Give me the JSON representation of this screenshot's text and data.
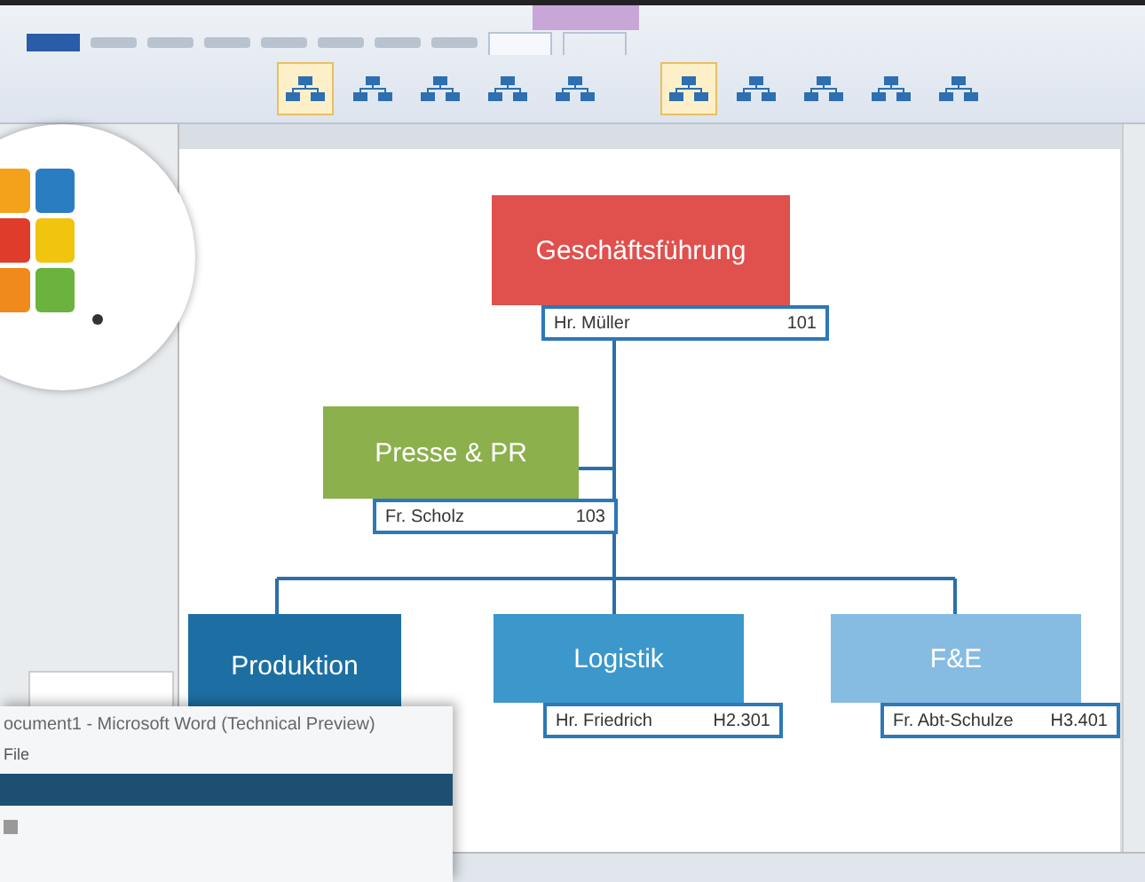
{
  "ribbon": {
    "contextual_tab_selected": true,
    "layout_gallery": [
      {
        "selected": true
      },
      {
        "selected": false
      },
      {
        "selected": false
      },
      {
        "selected": false
      },
      {
        "selected": false
      }
    ],
    "style_gallery": [
      {
        "selected": true
      },
      {
        "selected": false
      },
      {
        "selected": false
      },
      {
        "selected": false
      },
      {
        "selected": false
      }
    ]
  },
  "org_chart": {
    "nodes": [
      {
        "title": "Geschäftsführung",
        "color": "#e0504d",
        "person": "Hr. Müller",
        "room": "101"
      },
      {
        "title": "Presse & PR",
        "color": "#8cb04c",
        "person": "Fr. Scholz",
        "room": "103"
      },
      {
        "title": "Produktion",
        "color": "#1d6fa3"
      },
      {
        "title": "Logistik",
        "color": "#3c97cb",
        "person": "Hr. Friedrich",
        "room": "H2.301"
      },
      {
        "title": "F&E",
        "color": "#86bbe2",
        "person": "Fr. Abt-Schulze",
        "room": "H3.401"
      }
    ]
  },
  "second_window": {
    "title": "ocument1 - Microsoft Word (Technical Preview)",
    "menu": "File"
  }
}
